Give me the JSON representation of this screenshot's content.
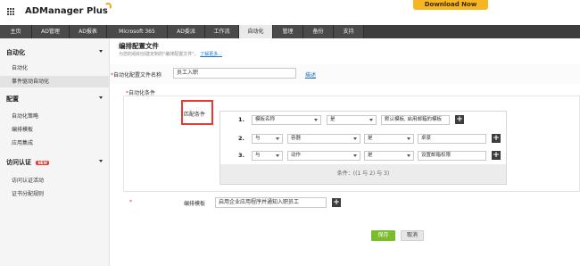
{
  "header": {
    "logo_text": "ADManager Plus",
    "download_label": "Download Now"
  },
  "nav": {
    "tabs": [
      {
        "label": "主页"
      },
      {
        "label": "AD管理"
      },
      {
        "label": "AD报表"
      },
      {
        "label": "Microsoft 365"
      },
      {
        "label": "AD委派"
      },
      {
        "label": "工作流"
      },
      {
        "label": "自动化"
      },
      {
        "label": "管理"
      },
      {
        "label": "备份"
      },
      {
        "label": "支持"
      }
    ],
    "active_tab": "自动化"
  },
  "sidebar": {
    "sections": [
      {
        "title": "自动化",
        "items": [
          "自动化",
          "事件驱动自动化"
        ]
      },
      {
        "title": "配置",
        "items": [
          "自动化策略",
          "编排模板",
          "应用集成"
        ]
      },
      {
        "title": "访问认证",
        "badge": "NEW",
        "items": [
          "访问认证活动",
          "证书分配规则"
        ]
      }
    ],
    "active_item": "事件驱动自动化"
  },
  "main": {
    "title": "编排配置文件",
    "subtitle": "为您的组织创建定制的\"编排配置文件\"。",
    "learn_more": "了解更多...",
    "profile_name_label": "自动化配置文件名称",
    "profile_name_value": "员工入职",
    "description_link": "描述",
    "automation_conditions_label": "自动化条件",
    "match_conditions_label": "匹配条件",
    "conditions": [
      {
        "num": "1.",
        "field": "模板名称",
        "operator": "是",
        "value": "默认模板, 启用邮箱的模板"
      },
      {
        "num": "2.",
        "logic": "与",
        "field": "容器",
        "operator": "是",
        "value": "卓豪"
      },
      {
        "num": "3.",
        "logic": "与",
        "field": "动作",
        "operator": "是",
        "value": "设置邮箱权限"
      }
    ],
    "condition_footer": "条件：((1 与 2) 与 3)",
    "template_label": "编排模板",
    "template_value": "启用企业应用程序并通知入职员工",
    "save_label": "保存",
    "cancel_label": "取消"
  },
  "colors": {
    "nav_bg": "#3d3d3d",
    "download_bg": "#f7b521",
    "save_bg": "#7cbb2d",
    "highlight_border": "#e53935",
    "link": "#1a73c7"
  }
}
